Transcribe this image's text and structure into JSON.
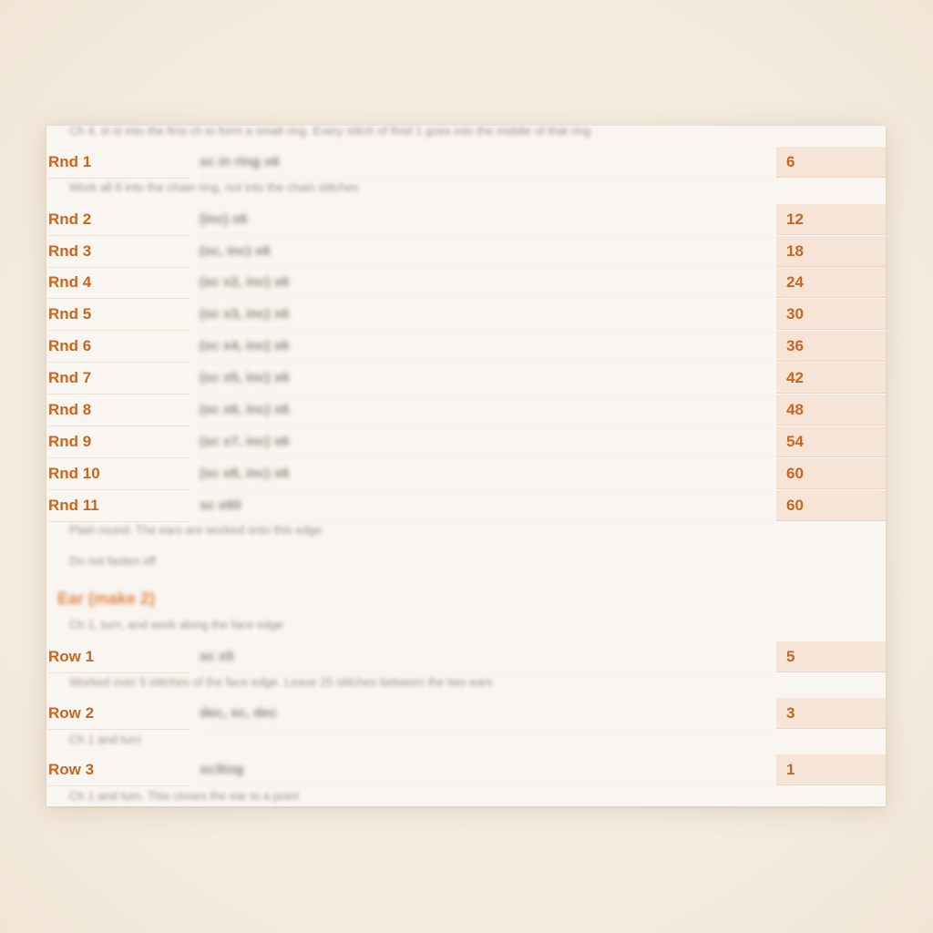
{
  "notes": {
    "intro": "Ch 4, sl st into the first ch to form a small ring. Every stitch of Rnd 1 goes into the middle of that ring",
    "after_rnd1": "Work all 6 into the chain ring, not into the chain stitches",
    "after_rnd11_a": "Plain round. The ears are worked onto this edge",
    "after_rnd11_b": "Do not fasten off",
    "ear_intro": "Ch 1, turn, and work along the face edge",
    "after_row1": "Worked over 5 stitches of the face edge. Leave 25 stitches between the two ears",
    "after_row2": "Ch 1 and turn",
    "after_row3": "Ch 1 and turn. This closes the ear to a point"
  },
  "ear_heading": "Ear (make 2)",
  "rounds": [
    {
      "label": "Rnd 1",
      "instruction": "sc in ring x6",
      "count": "6"
    },
    {
      "label": "Rnd 2",
      "instruction": "(inc) x6",
      "count": "12"
    },
    {
      "label": "Rnd 3",
      "instruction": "(sc, inc) x6",
      "count": "18"
    },
    {
      "label": "Rnd 4",
      "instruction": "(sc x2, inc) x6",
      "count": "24"
    },
    {
      "label": "Rnd 5",
      "instruction": "(sc x3, inc) x6",
      "count": "30"
    },
    {
      "label": "Rnd 6",
      "instruction": "(sc x4, inc) x6",
      "count": "36"
    },
    {
      "label": "Rnd 7",
      "instruction": "(sc x5, inc) x6",
      "count": "42"
    },
    {
      "label": "Rnd 8",
      "instruction": "(sc x6, inc) x6",
      "count": "48"
    },
    {
      "label": "Rnd 9",
      "instruction": "(sc x7, inc) x6",
      "count": "54"
    },
    {
      "label": "Rnd 10",
      "instruction": "(sc x8, inc) x6",
      "count": "60"
    },
    {
      "label": "Rnd 11",
      "instruction": "sc x60",
      "count": "60"
    }
  ],
  "ear_rows": [
    {
      "label": "Row 1",
      "instruction": "sc x5",
      "count": "5"
    },
    {
      "label": "Row 2",
      "instruction": "dec, sc, dec",
      "count": "3"
    },
    {
      "label": "Row 3",
      "instruction": "sc3tog",
      "count": "1"
    }
  ]
}
